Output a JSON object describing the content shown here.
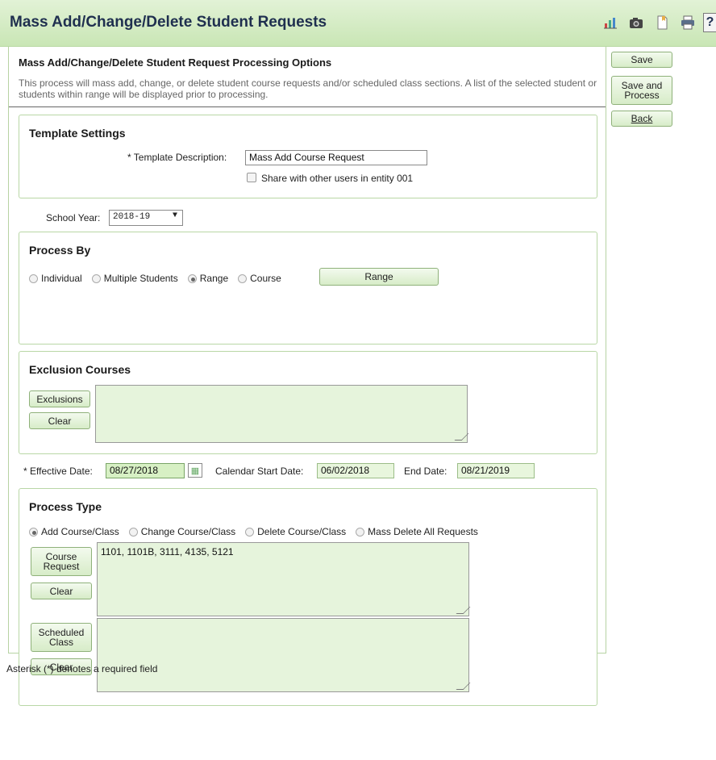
{
  "header": {
    "title": "Mass Add/Change/Delete Student Requests",
    "icons": [
      "report-icon",
      "camera-icon",
      "bookmark-icon",
      "print-icon",
      "help-icon"
    ],
    "help_label": "?"
  },
  "actions": {
    "save": "Save",
    "save_process_line1": "Save and",
    "save_process_line2": "Process",
    "back": "Back"
  },
  "main": {
    "title": "Mass Add/Change/Delete Student Request Processing Options",
    "description": "This process will mass add, change, or delete student course requests and/or scheduled class sections. A list of the selected student or students within range will be displayed prior to processing."
  },
  "template_settings": {
    "title": "Template Settings",
    "description_label": "* Template Description:",
    "description_value": "Mass Add Course Request",
    "share_label": "Share with other users in entity 001",
    "share_checked": false
  },
  "school_year": {
    "label": "School Year:",
    "value": "2018-19"
  },
  "process_by": {
    "title": "Process By",
    "options": [
      "Individual",
      "Multiple Students",
      "Range",
      "Course"
    ],
    "selected": "Range",
    "range_button": "Range"
  },
  "exclusion_courses": {
    "title": "Exclusion Courses",
    "exclusions_button": "Exclusions",
    "clear_button": "Clear",
    "value": ""
  },
  "dates": {
    "effective_label": "* Effective Date:",
    "effective_value": "08/27/2018",
    "calendar_start_label": "Calendar Start Date:",
    "calendar_start_value": "06/02/2018",
    "end_label": "End Date:",
    "end_value": "08/21/2019"
  },
  "process_type": {
    "title": "Process Type",
    "options": [
      "Add Course/Class",
      "Change Course/Class",
      "Delete Course/Class",
      "Mass Delete All Requests"
    ],
    "selected": "Add Course/Class",
    "course_request_line1": "Course",
    "course_request_line2": "Request",
    "course_request_value": "1101, 1101B, 3111, 4135, 5121",
    "clear_button": "Clear",
    "scheduled_class_line1": "Scheduled",
    "scheduled_class_line2": "Class",
    "scheduled_class_value": ""
  },
  "footer": {
    "note": "Asterisk (*) denotes a required field"
  },
  "colors": {
    "header_bg": "#cfe9bd",
    "panel_border": "#b9d7a6",
    "field_green": "#d7f0c4",
    "title_text": "#1f2f4f"
  }
}
